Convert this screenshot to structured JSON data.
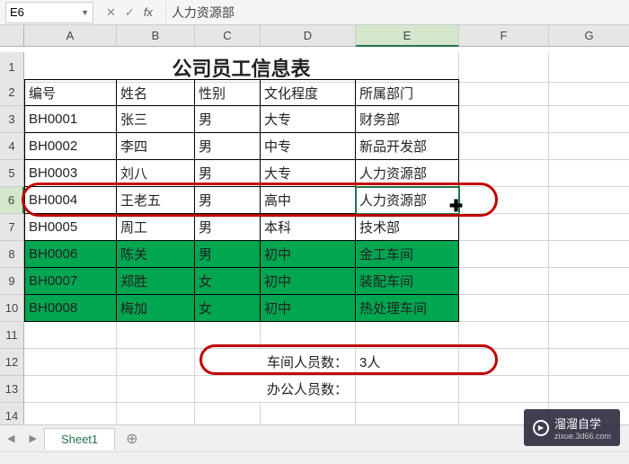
{
  "cell_ref": "E6",
  "formula_value": "人力资源部",
  "columns": [
    "A",
    "B",
    "C",
    "D",
    "E",
    "F",
    "G"
  ],
  "selected_col": 4,
  "title": "公司员工信息表",
  "headers": [
    "编号",
    "姓名",
    "性别",
    "文化程度",
    "所属部门"
  ],
  "rows": [
    {
      "n": "3",
      "id": "BH0001",
      "name": "张三",
      "sex": "男",
      "edu": "大专",
      "dept": "财务部",
      "green": false
    },
    {
      "n": "4",
      "id": "BH0002",
      "name": "李四",
      "sex": "男",
      "edu": "中专",
      "dept": "新品开发部",
      "green": false
    },
    {
      "n": "5",
      "id": "BH0003",
      "name": "刘八",
      "sex": "男",
      "edu": "大专",
      "dept": "人力资源部",
      "green": false
    },
    {
      "n": "6",
      "id": "BH0004",
      "name": "王老五",
      "sex": "男",
      "edu": "高中",
      "dept": "人力资源部",
      "green": false,
      "selected": true
    },
    {
      "n": "7",
      "id": "BH0005",
      "name": "周工",
      "sex": "男",
      "edu": "本科",
      "dept": "技术部",
      "green": false
    },
    {
      "n": "8",
      "id": "BH0006",
      "name": "陈关",
      "sex": "男",
      "edu": "初中",
      "dept": "金工车间",
      "green": true
    },
    {
      "n": "9",
      "id": "BH0007",
      "name": "郑胜",
      "sex": "女",
      "edu": "初中",
      "dept": "装配车间",
      "green": true
    },
    {
      "n": "10",
      "id": "BH0008",
      "name": "梅加",
      "sex": "女",
      "edu": "初中",
      "dept": "热处理车间",
      "green": true
    }
  ],
  "summary": {
    "row12_label": "车间人员数：",
    "row12_value": "3人",
    "row13_label": "办公人员数："
  },
  "tab_name": "Sheet1",
  "watermark": {
    "brand": "溜溜自学",
    "url": "zixue.3d66.com"
  },
  "chart_data": {
    "type": "table",
    "title": "公司员工信息表",
    "columns": [
      "编号",
      "姓名",
      "性别",
      "文化程度",
      "所属部门"
    ],
    "data": [
      [
        "BH0001",
        "张三",
        "男",
        "大专",
        "财务部"
      ],
      [
        "BH0002",
        "李四",
        "男",
        "中专",
        "新品开发部"
      ],
      [
        "BH0003",
        "刘八",
        "男",
        "大专",
        "人力资源部"
      ],
      [
        "BH0004",
        "王老五",
        "男",
        "高中",
        "人力资源部"
      ],
      [
        "BH0005",
        "周工",
        "男",
        "本科",
        "技术部"
      ],
      [
        "BH0006",
        "陈关",
        "男",
        "初中",
        "金工车间"
      ],
      [
        "BH0007",
        "郑胜",
        "女",
        "初中",
        "装配车间"
      ],
      [
        "BH0008",
        "梅加",
        "女",
        "初中",
        "热处理车间"
      ]
    ],
    "summary": {
      "车间人员数": "3人"
    }
  }
}
